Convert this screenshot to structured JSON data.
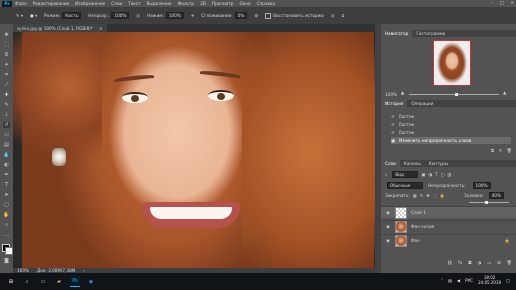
{
  "menubar": {
    "logo": "Ps",
    "items": [
      "Файл",
      "Редактирование",
      "Изображение",
      "Слои",
      "Текст",
      "Выделение",
      "Фильтр",
      "3D",
      "Просмотр",
      "Окно",
      "Справка"
    ],
    "minimize": "–",
    "maximize": "□",
    "close": "✕"
  },
  "options": {
    "mode_label": "Режим:",
    "mode_value": "Кисть",
    "opacity_label": "Непрозр.:",
    "opacity_value": "100%",
    "flow_label": "Нажим:",
    "flow_value": "100%",
    "smoothing_label": "Сглаживание:",
    "smoothing_value": "0%",
    "history_label": "Восстановить историю"
  },
  "document": {
    "tab_title": "sylvia.jpg @ 100% (Слой 1, RGB/8)*",
    "close": "✕"
  },
  "status": {
    "zoom": "100%",
    "doc_info": "Док: 3,00M/7,38M"
  },
  "navigator": {
    "tabs": [
      "Навигатор",
      "Гистограмма"
    ],
    "zoom": "100%"
  },
  "history": {
    "tabs": [
      "История",
      "Операции"
    ],
    "items": [
      "Ластик",
      "Ластик",
      "Ластик",
      "Изменить непрозрачность слоев"
    ]
  },
  "layers": {
    "tabs": [
      "Слои",
      "Каналы",
      "Контуры"
    ],
    "filter_label": "Вид",
    "blend_mode": "Обычные",
    "opacity_label": "Непрозрачность:",
    "opacity_value": "100%",
    "lock_label": "Закрепить:",
    "fill_label": "Заливка:",
    "fill_value": "40%",
    "rows": [
      {
        "name": "Слой 1"
      },
      {
        "name": "Фон копия"
      },
      {
        "name": "Фон"
      }
    ]
  },
  "taskbar": {
    "lang": "РУС",
    "time": "18:02",
    "date": "24.05.2019"
  }
}
